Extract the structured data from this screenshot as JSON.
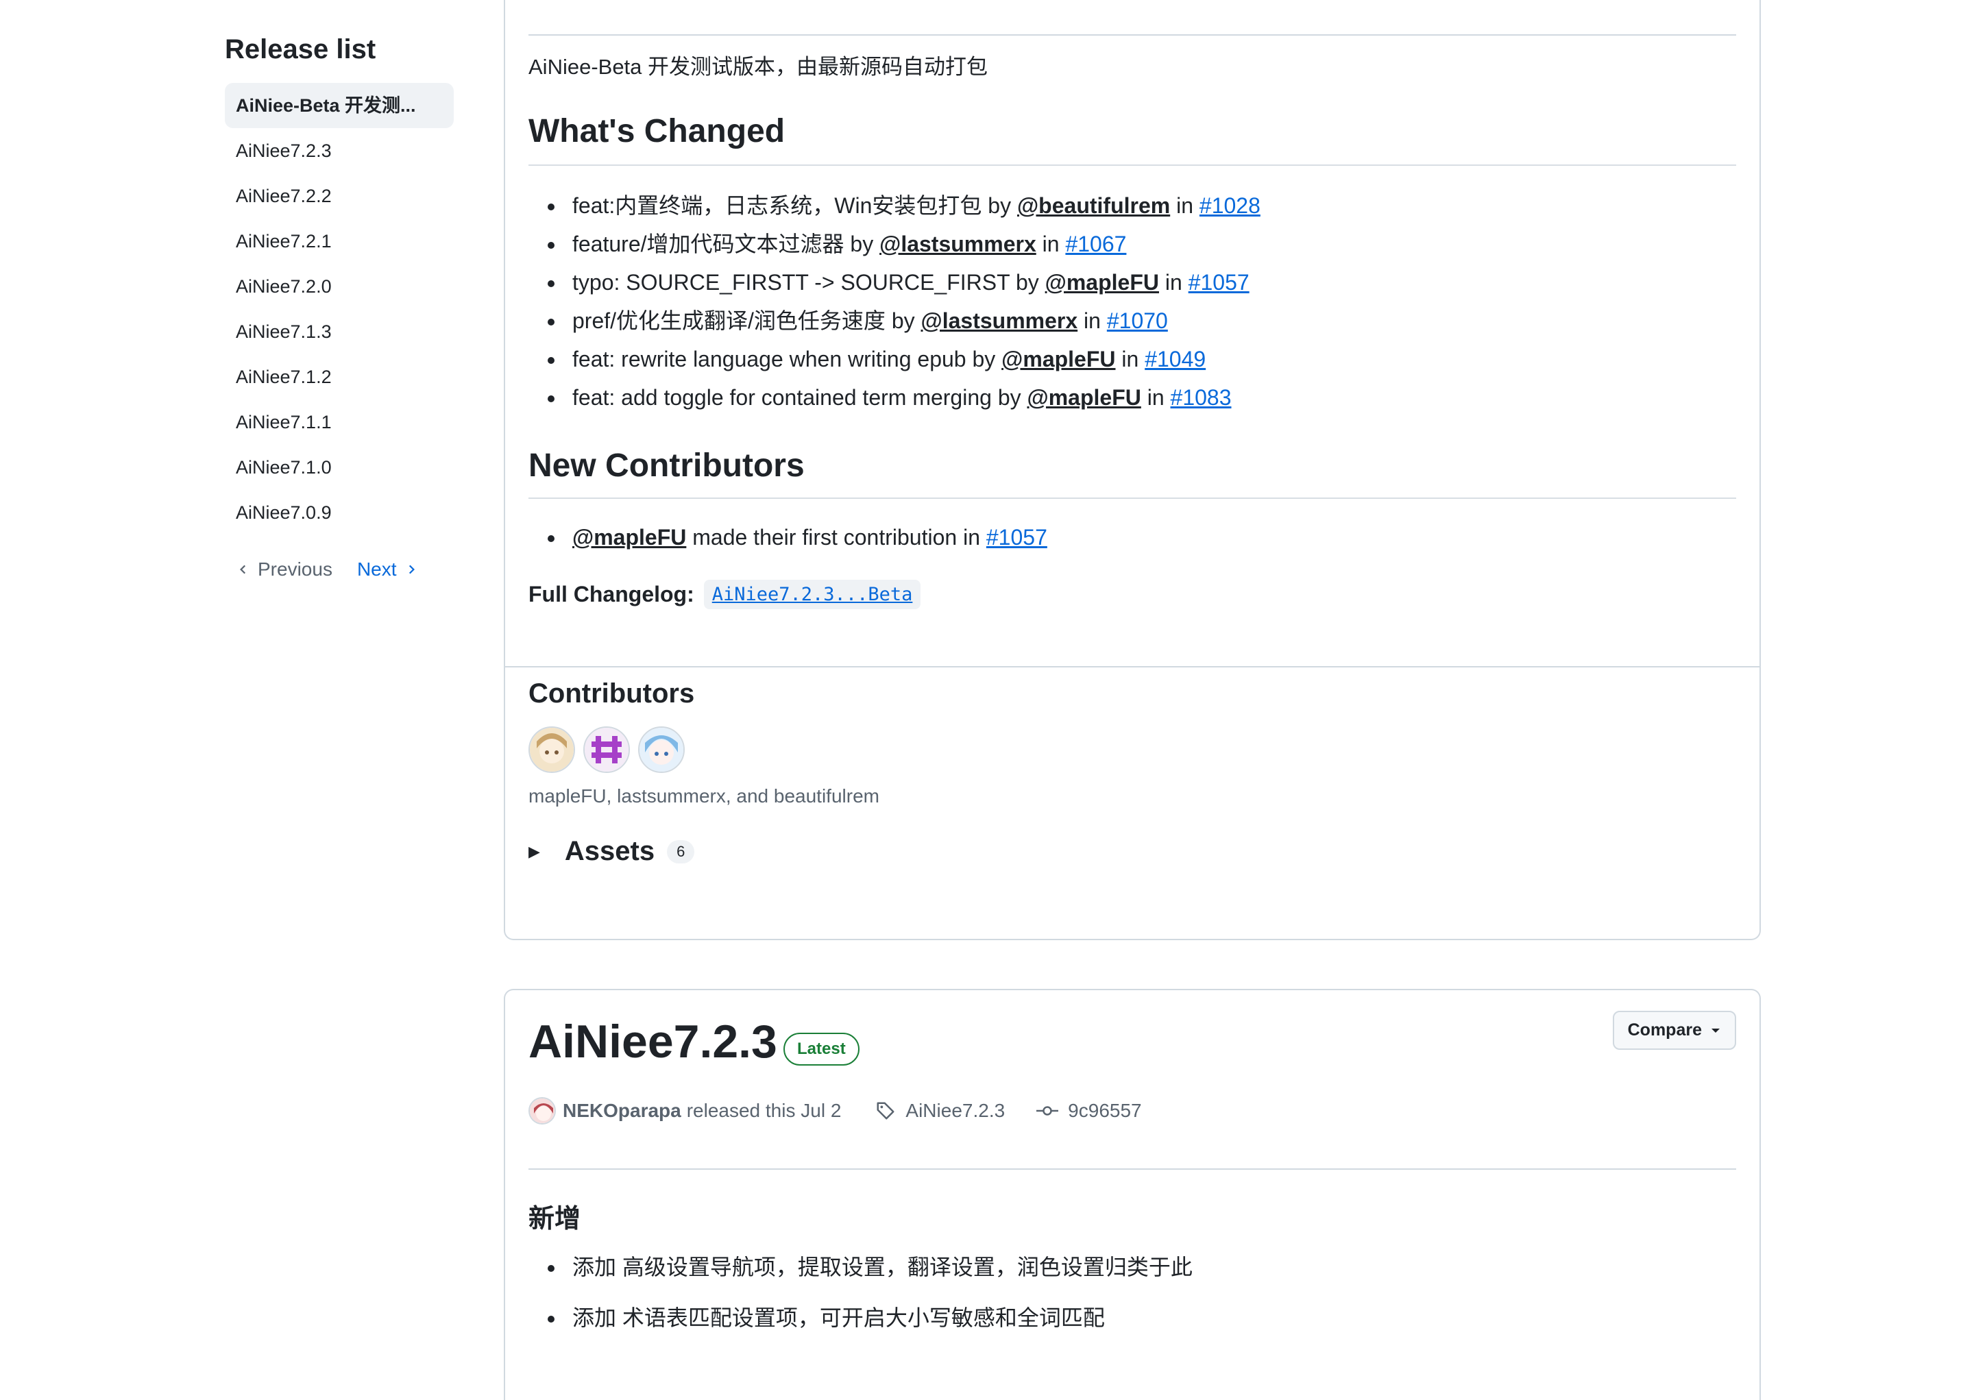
{
  "sidebar": {
    "title": "Release list",
    "items": [
      "AiNiee-Beta 开发测...",
      "AiNiee7.2.3",
      "AiNiee7.2.2",
      "AiNiee7.2.1",
      "AiNiee7.2.0",
      "AiNiee7.1.3",
      "AiNiee7.1.2",
      "AiNiee7.1.1",
      "AiNiee7.1.0",
      "AiNiee7.0.9"
    ],
    "prev_label": "Previous",
    "next_label": "Next"
  },
  "beta": {
    "description": "AiNiee-Beta 开发测试版本，由最新源码自动打包",
    "whats_changed": "What's Changed",
    "changes": [
      {
        "text": "feat:内置终端，日志系统，Win安装包打包 by ",
        "user": "@beautifulrem",
        "in": " in ",
        "pr": "#1028"
      },
      {
        "text": "feature/增加代码文本过滤器 by ",
        "user": "@lastsummerx",
        "in": " in ",
        "pr": "#1067"
      },
      {
        "text": "typo: SOURCE_FIRSTT -> SOURCE_FIRST by ",
        "user": "@mapleFU",
        "in": " in ",
        "pr": "#1057"
      },
      {
        "text": "pref/优化生成翻译/润色任务速度 by ",
        "user": "@lastsummerx",
        "in": " in ",
        "pr": "#1070"
      },
      {
        "text": "feat: rewrite language when writing epub by ",
        "user": "@mapleFU",
        "in": " in ",
        "pr": "#1049"
      },
      {
        "text": "feat: add toggle for contained term merging by ",
        "user": "@mapleFU",
        "in": " in ",
        "pr": "#1083"
      }
    ],
    "new_contributors": "New Contributors",
    "new_contrib": {
      "user": "@mapleFU",
      "text": " made their first contribution in ",
      "pr": "#1057"
    },
    "changelog_label": "Full Changelog:",
    "changelog_link": "AiNiee7.2.3...Beta",
    "contributors_title": "Contributors",
    "contributors_names": "mapleFU, lastsummerx, and beautifulrem",
    "assets_label": "Assets",
    "assets_count": "6"
  },
  "release": {
    "title": "AiNiee7.2.3",
    "latest_label": "Latest",
    "compare_label": "Compare",
    "author": "NEKOparapa",
    "released_text": "released this Jul 2",
    "tag": "AiNiee7.2.3",
    "commit": "9c96557",
    "section_title": "新增",
    "items": [
      "添加 高级设置导航项，提取设置，翻译设置，润色设置归类于此",
      "添加 术语表匹配设置项，可开启大小写敏感和全词匹配"
    ]
  },
  "colors": {
    "accent": "#0969da",
    "latest": "#1a7f37",
    "border": "#d1d9e0"
  }
}
